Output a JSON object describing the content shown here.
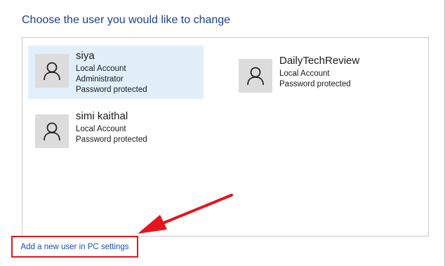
{
  "page": {
    "title": "Choose the user you would like to change"
  },
  "users": [
    {
      "name": "siya",
      "lines": [
        "Local Account",
        "Administrator",
        "Password protected"
      ],
      "selected": true
    },
    {
      "name": "DailyTechReview",
      "lines": [
        "Local Account",
        "Password protected"
      ],
      "selected": false
    },
    {
      "name": "simi kaithal",
      "lines": [
        "Local Account",
        "Password protected"
      ],
      "selected": false
    }
  ],
  "footer": {
    "add_user_link": "Add a new user in PC settings"
  },
  "colors": {
    "title": "#1e3f8c",
    "link": "#1a4fb5",
    "selected_tile": "#e1effb",
    "annotation_red": "#e5141d"
  },
  "icons": {
    "avatar": "user-avatar-icon",
    "arrow": "red-arrow-annotation"
  }
}
